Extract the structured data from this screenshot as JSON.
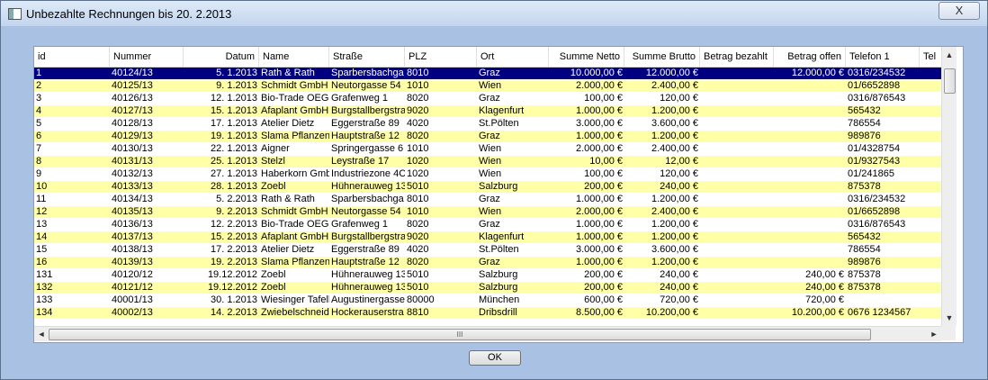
{
  "window": {
    "title": "Unbezahlte Rechnungen bis 20.  2.2013",
    "close_glyph": "X"
  },
  "table": {
    "columns": [
      {
        "key": "id",
        "label": "id"
      },
      {
        "key": "nummer",
        "label": "Nummer"
      },
      {
        "key": "datum",
        "label": "Datum"
      },
      {
        "key": "name",
        "label": "Name"
      },
      {
        "key": "strasse",
        "label": "Straße"
      },
      {
        "key": "plz",
        "label": "PLZ"
      },
      {
        "key": "ort",
        "label": "Ort"
      },
      {
        "key": "netto",
        "label": "Summe Netto"
      },
      {
        "key": "brutto",
        "label": "Summe Brutto"
      },
      {
        "key": "bezahlt",
        "label": "Betrag bezahlt"
      },
      {
        "key": "offen",
        "label": "Betrag offen"
      },
      {
        "key": "telefon",
        "label": "Telefon 1"
      },
      {
        "key": "tel2",
        "label": "Tel"
      }
    ],
    "selected_row": 0,
    "row_colors": {
      "odd": "#ffffff",
      "even": "#ffffa8",
      "selected": "#000080",
      "selected_text": "#ffffff"
    },
    "rows": [
      [
        "1",
        "40124/13",
        "5.  1.2013",
        "Rath & Rath",
        "Sparbersbachga",
        "8010",
        "Graz",
        "10.000,00 €",
        "12.000,00 €",
        "",
        "12.000,00 €",
        "0316/234532",
        ""
      ],
      [
        "2",
        "40125/13",
        "9.  1.2013",
        "Schmidt GmbH",
        "Neutorgasse 54",
        "1010",
        "Wien",
        "2.000,00 €",
        "2.400,00 €",
        "",
        "",
        "01/6652898",
        ""
      ],
      [
        "3",
        "40126/13",
        "12.  1.2013",
        "Bio-Trade OEG",
        "Grafenweg 1",
        "8020",
        "Graz",
        "100,00 €",
        "120,00 €",
        "",
        "",
        "0316/876543",
        ""
      ],
      [
        "4",
        "40127/13",
        "15.  1.2013",
        "Afaplant GmbH",
        "Burgstallbergstra",
        "9020",
        "Klagenfurt",
        "1.000,00 €",
        "1.200,00 €",
        "",
        "",
        "565432",
        ""
      ],
      [
        "5",
        "40128/13",
        "17.  1.2013",
        "Atelier Dietz",
        "Eggerstraße 89",
        "4020",
        "St.Pölten",
        "3.000,00 €",
        "3.600,00 €",
        "",
        "",
        "786554",
        ""
      ],
      [
        "6",
        "40129/13",
        "19.  1.2013",
        "Slama Pflanzend",
        "Hauptstraße 12",
        "8020",
        "Graz",
        "1.000,00 €",
        "1.200,00 €",
        "",
        "",
        "989876",
        ""
      ],
      [
        "7",
        "40130/13",
        "22.  1.2013",
        "Aigner",
        "Springergasse 6",
        "1010",
        "Wien",
        "2.000,00 €",
        "2.400,00 €",
        "",
        "",
        "01/4328754",
        ""
      ],
      [
        "8",
        "40131/13",
        "25.  1.2013",
        "Stelzl",
        "Leystraße 17",
        "1020",
        "Wien",
        "10,00 €",
        "12,00 €",
        "",
        "",
        "01/9327543",
        ""
      ],
      [
        "9",
        "40132/13",
        "27.  1.2013",
        "Haberkorn Gmb",
        "Industriezone 4C",
        "1020",
        "Wien",
        "100,00 €",
        "120,00 €",
        "",
        "",
        "01/241865",
        ""
      ],
      [
        "10",
        "40133/13",
        "28.  1.2013",
        "Zoebl",
        "Hühnerauweg 13",
        "5010",
        "Salzburg",
        "200,00 €",
        "240,00 €",
        "",
        "",
        "875378",
        ""
      ],
      [
        "11",
        "40134/13",
        "5.  2.2013",
        "Rath & Rath",
        "Sparbersbachga",
        "8010",
        "Graz",
        "1.000,00 €",
        "1.200,00 €",
        "",
        "",
        "0316/234532",
        ""
      ],
      [
        "12",
        "40135/13",
        "9.  2.2013",
        "Schmidt GmbH",
        "Neutorgasse 54",
        "1010",
        "Wien",
        "2.000,00 €",
        "2.400,00 €",
        "",
        "",
        "01/6652898",
        ""
      ],
      [
        "13",
        "40136/13",
        "12.  2.2013",
        "Bio-Trade OEG",
        "Grafenweg 1",
        "8020",
        "Graz",
        "1.000,00 €",
        "1.200,00 €",
        "",
        "",
        "0316/876543",
        ""
      ],
      [
        "14",
        "40137/13",
        "15.  2.2013",
        "Afaplant GmbH",
        "Burgstallbergstra",
        "9020",
        "Klagenfurt",
        "1.000,00 €",
        "1.200,00 €",
        "",
        "",
        "565432",
        ""
      ],
      [
        "15",
        "40138/13",
        "17.  2.2013",
        "Atelier Dietz",
        "Eggerstraße 89",
        "4020",
        "St.Pölten",
        "3.000,00 €",
        "3.600,00 €",
        "",
        "",
        "786554",
        ""
      ],
      [
        "16",
        "40139/13",
        "19.  2.2013",
        "Slama Pflanzend",
        "Hauptstraße 12",
        "8020",
        "Graz",
        "1.000,00 €",
        "1.200,00 €",
        "",
        "",
        "989876",
        ""
      ],
      [
        "131",
        "40120/12",
        "19.12.2012",
        "Zoebl",
        "Hühnerauweg 13",
        "5010",
        "Salzburg",
        "200,00 €",
        "240,00 €",
        "",
        "240,00 €",
        "875378",
        ""
      ],
      [
        "132",
        "40121/12",
        "19.12.2012",
        "Zoebl",
        "Hühnerauweg 13",
        "5010",
        "Salzburg",
        "200,00 €",
        "240,00 €",
        "",
        "240,00 €",
        "875378",
        ""
      ],
      [
        "133",
        "40001/13",
        "30.  1.2013",
        "Wiesinger Tafelb",
        "Augustinergasse",
        "80000",
        "München",
        "600,00 €",
        "720,00 €",
        "",
        "720,00 €",
        "",
        ""
      ],
      [
        "134",
        "40002/13",
        "14.  2.2013",
        "Zwiebelschneide",
        "Hockerauserstra",
        "8810",
        "Dribsdrill",
        "8.500,00 €",
        "10.200,00 €",
        "",
        "10.200,00 €",
        "0676 1234567",
        ""
      ]
    ]
  },
  "scrollbar": {
    "up": "▲",
    "down": "▼",
    "left": "◄",
    "right": "►",
    "grip": "III"
  },
  "footer": {
    "ok_label": "OK"
  }
}
